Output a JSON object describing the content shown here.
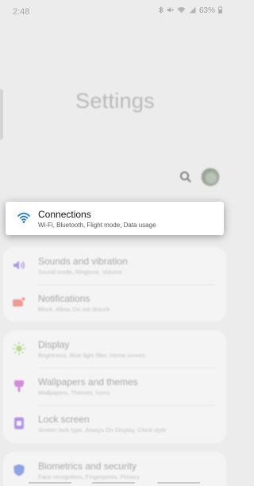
{
  "status_bar": {
    "time": "2:48",
    "battery": "63%",
    "icons": [
      "bluetooth-icon",
      "mute-icon",
      "wifi-icon",
      "signal-icon",
      "battery-icon"
    ]
  },
  "page": {
    "title": "Settings"
  },
  "header_actions": {
    "search_icon": "search-icon",
    "avatar": "profile-avatar"
  },
  "highlighted_item": {
    "title": "Connections",
    "subtitle": "Wi-Fi, Bluetooth, Flight mode, Data usage",
    "icon": "wifi-icon",
    "accent": "#1a73c9"
  },
  "groups": [
    {
      "items": [
        {
          "title": "Sounds and vibration",
          "subtitle": "Sound mode, Ringtone, Volume",
          "icon": "volume-icon",
          "color": "#a998e0"
        },
        {
          "title": "Notifications",
          "subtitle": "Block, Allow, Do not disturb",
          "icon": "notification-icon",
          "color": "#ef9b95"
        }
      ]
    },
    {
      "items": [
        {
          "title": "Display",
          "subtitle": "Brightness, Blue light filter, Home screen",
          "icon": "brightness-icon",
          "color": "#b9d68a"
        },
        {
          "title": "Wallpapers and themes",
          "subtitle": "Wallpapers, Themes, Icons",
          "icon": "brush-icon",
          "color": "#d28ad6"
        },
        {
          "title": "Lock screen",
          "subtitle": "Screen lock type, Always On Display, Clock style",
          "icon": "lock-icon",
          "color": "#b394e4"
        }
      ]
    },
    {
      "items": [
        {
          "title": "Biometrics and security",
          "subtitle": "Face recognition, Fingerprints, Privacy",
          "icon": "shield-icon",
          "color": "#8fa3e4"
        }
      ]
    }
  ]
}
